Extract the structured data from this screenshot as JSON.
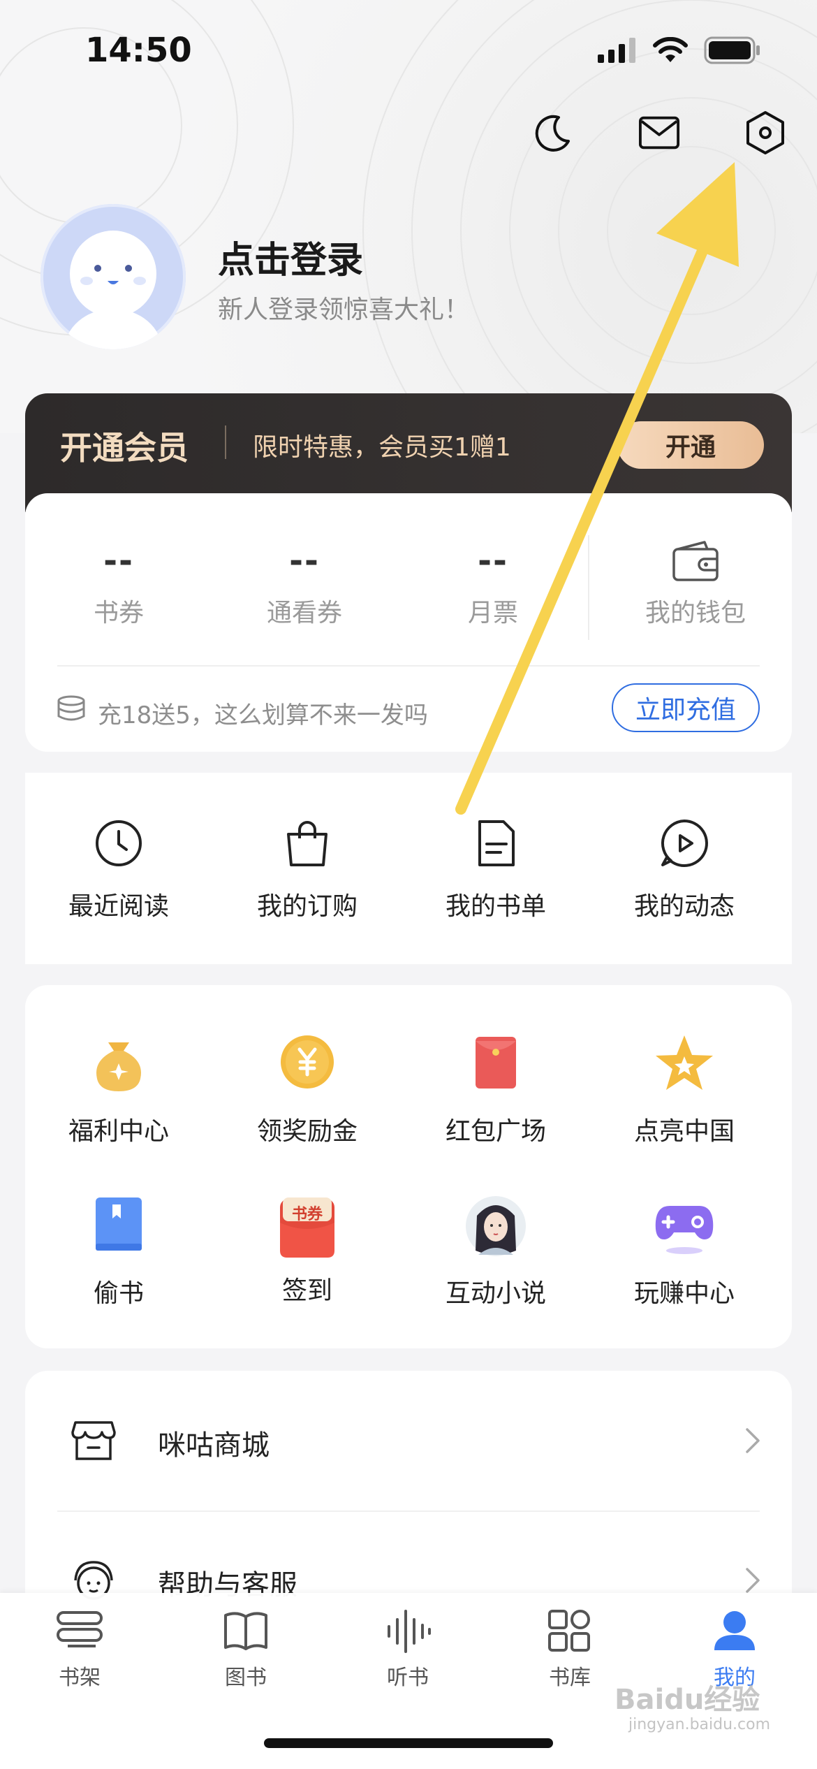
{
  "status_bar": {
    "time": "14:50"
  },
  "profile": {
    "title": "点击登录",
    "subtitle": "新人登录领惊喜大礼！"
  },
  "vip": {
    "title": "开通会员",
    "promo": "限时特惠，会员买1赠1",
    "button": "开通"
  },
  "assets": {
    "items": [
      {
        "value": "--",
        "label": "书券"
      },
      {
        "value": "--",
        "label": "通看券"
      },
      {
        "value": "--",
        "label": "月票"
      }
    ],
    "wallet_label": "我的钱包",
    "recharge_text": "充18送5，这么划算不来一发吗",
    "recharge_button": "立即充值"
  },
  "quick": [
    {
      "label": "最近阅读",
      "icon": "clock-icon"
    },
    {
      "label": "我的订购",
      "icon": "bag-icon"
    },
    {
      "label": "我的书单",
      "icon": "document-icon"
    },
    {
      "label": "我的动态",
      "icon": "play-bubble-icon"
    }
  ],
  "services": [
    {
      "label": "福利中心",
      "icon": "money-bag-icon"
    },
    {
      "label": "领奖励金",
      "icon": "yuan-coin-icon"
    },
    {
      "label": "红包广场",
      "icon": "red-envelope-icon"
    },
    {
      "label": "点亮中国",
      "icon": "star-icon"
    },
    {
      "label": "偷书",
      "icon": "blue-book-icon"
    },
    {
      "label": "签到",
      "icon": "coupon-icon",
      "badge": "书券"
    },
    {
      "label": "互动小说",
      "icon": "character-avatar-icon"
    },
    {
      "label": "玩赚中心",
      "icon": "gamepad-icon"
    }
  ],
  "menu": [
    {
      "label": "咪咕商城",
      "icon": "shop-icon"
    },
    {
      "label": "帮助与客服",
      "icon": "support-icon"
    }
  ],
  "tabs": [
    {
      "label": "书架",
      "icon": "bookshelf-icon"
    },
    {
      "label": "图书",
      "icon": "open-book-icon"
    },
    {
      "label": "听书",
      "icon": "soundwave-icon"
    },
    {
      "label": "书库",
      "icon": "grid-icon"
    },
    {
      "label": "我的",
      "icon": "person-icon",
      "active": true
    }
  ],
  "watermark": {
    "text": "Baidu经验",
    "sub": "jingyan.baidu.com"
  },
  "colors": {
    "accent": "#2f6de1",
    "tab_active": "#3b7cf2",
    "arrow": "#f7d24f",
    "vip_bg": "#2d2a2a"
  }
}
